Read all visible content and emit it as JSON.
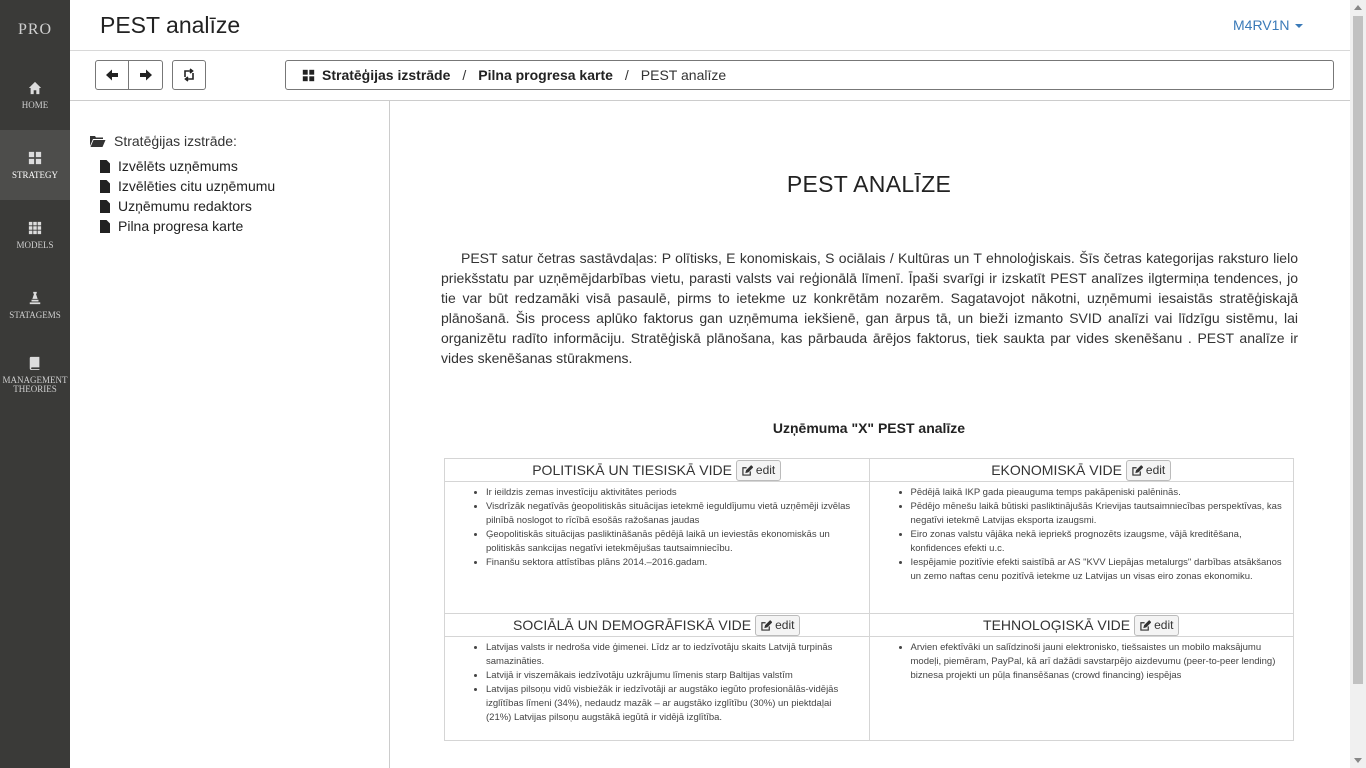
{
  "app": {
    "brand": "PRO",
    "page_title": "PEST analīze",
    "user": "M4RV1N"
  },
  "sidebar": {
    "items": [
      {
        "label": "HOME",
        "icon": "home-icon"
      },
      {
        "label": "STRATEGY",
        "icon": "grid-icon",
        "active": true
      },
      {
        "label": "MODELS",
        "icon": "apps-icon"
      },
      {
        "label": "STATAGEMS",
        "icon": "chess-icon"
      },
      {
        "label": "MANAGEMENT THEORIES",
        "icon": "book-icon"
      }
    ]
  },
  "breadcrumb": {
    "root": "Stratēģijas izstrāde",
    "middle": "Pilna progresa karte",
    "current": "PEST analīze",
    "separator": "/"
  },
  "tree": {
    "root": "Stratēģijas izstrāde:",
    "items": [
      "Izvēlēts uzņēmums",
      "Izvēlēties citu uzņēmumu",
      "Uzņēmumu redaktors",
      "Pilna progresa karte"
    ]
  },
  "main": {
    "heading": "PEST ANALĪZE",
    "intro": "PEST satur četras sastāvdaļas: P olītisks, E konomiskais, S ociālais / Kultūras un T ehnoloģiskais. Šīs četras kategorijas raksturo lielo priekšstatu par uzņēmējdarbības vietu, parasti valsts vai reģionālā līmenī. Īpaši svarīgi ir izskatīt PEST analīzes ilgtermiņa tendences, jo tie var būt redzamāki visā pasaulē, pirms to ietekme uz konkrētām nozarēm. Sagatavojot nākotni, uzņēmumi iesaistās stratēģiskajā plānošanā. Šis process aplūko faktorus gan uzņēmuma iekšienē, gan ārpus tā, un bieži izmanto SVID analīzi vai līdzīgu sistēmu, lai organizētu radīto informāciju. Stratēģiskā plānošana, kas pārbauda ārējos faktorus, tiek saukta par vides skenēšanu . PEST analīze ir vides skenēšanas stūrakmens.",
    "table_caption": "Uzņēmuma \"X\" PEST analīze",
    "edit_label": "edit",
    "quadrants": {
      "political": {
        "title": "POLITISKĀ UN TIESISKĀ VIDE",
        "items": [
          "Ir ieildzis zemas investīciju aktivitātes periods",
          "Visdrīzāk negatīvās ģeopolitiskās situācijas ietekmē ieguldījumu vietā uzņēmēji izvēlas pilnībā noslogot to rīcībā esošās ražošanas jaudas",
          "Ģeopolitiskās situācijas pasliktināšanās pēdējā laikā un ieviestās ekonomiskās un politiskās sankcijas negatīvi ietekmējušas tautsaimniecību.",
          "Finanšu sektora attīstības plāns 2014.–2016.gadam."
        ]
      },
      "economic": {
        "title": "EKONOMISKĀ VIDE",
        "items": [
          "Pēdējā laikā IKP gada pieauguma temps pakāpeniski palēninās.",
          "Pēdējo mēnešu laikā būtiski pasliktinājušās Krievijas tautsaimniecības perspektīvas, kas negatīvi ietekmē Latvijas eksporta izaugsmi.",
          "Eiro zonas valstu vājāka nekā iepriekš prognozēts izaugsme, vājā kreditēšana, konfidences efekti u.c.",
          "Iespējamie pozitīvie efekti saistībā ar AS \"KVV Liepājas metalurgs\" darbības atsākšanos un zemo naftas cenu pozitīvā ietekme uz Latvijas un visas eiro zonas ekonomiku."
        ]
      },
      "social": {
        "title": "SOCIĀLĀ UN DEMOGRĀFISKĀ VIDE",
        "items": [
          "Latvijas valsts ir nedroša vide ģimenei. Līdz ar to iedzīvotāju skaits Latvijā turpinās samazināties.",
          "Latvijā ir viszemākais iedzīvotāju uzkrājumu līmenis starp Baltijas valstīm",
          "Latvijas pilsoņu vidū visbiežāk ir iedzīvotāji ar augstāko iegūto profesionālās-vidējās izglītības līmeni (34%), nedaudz mazāk – ar augstāko izglītību (30%) un piektdaļai (21%) Latvijas pilsoņu augstākā iegūtā ir vidējā izglītība."
        ]
      },
      "technological": {
        "title": "TEHNOLOĢISKĀ VIDE",
        "items": [
          "Arvien efektīvāki un salīdzinoši jauni elektronisko, tiešsaistes un mobilo maksājumu modeļi, piemēram, PayPal, kā arī dažādi savstarpējo aizdevumu (peer-to-peer lending) biznesa projekti un pūļa finansēšanas (crowd financing) iespējas"
        ]
      }
    }
  }
}
